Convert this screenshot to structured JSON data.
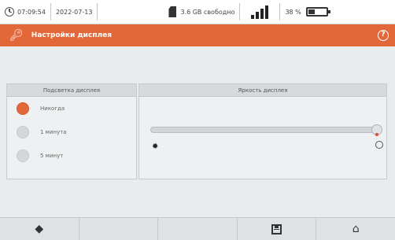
{
  "status": {
    "time": "07:09:54",
    "date": "2022-07-13",
    "storage": "3.6 GB свободно",
    "battery_level": "38 %",
    "battery_fraction": 0.38,
    "signal_bars": 4
  },
  "title_bar": {
    "title": "Настройки дисплея",
    "icons": [
      "wrench-icon",
      "help-icon"
    ]
  },
  "display_mode": {
    "header": "Подсветка дисплея",
    "options": [
      {
        "label": "Никогда",
        "selected": true
      },
      {
        "label": "1 минута",
        "selected": false
      },
      {
        "label": "5 минут",
        "selected": false
      }
    ]
  },
  "brightness": {
    "header": "Яркость дисплея",
    "value_fraction": 1.0
  },
  "bottom_bar": {
    "buttons": [
      "back-icon",
      "",
      "",
      "save-icon",
      "home-icon"
    ]
  },
  "colors": {
    "accent": "#e2683a",
    "background": "#e9ecef"
  }
}
